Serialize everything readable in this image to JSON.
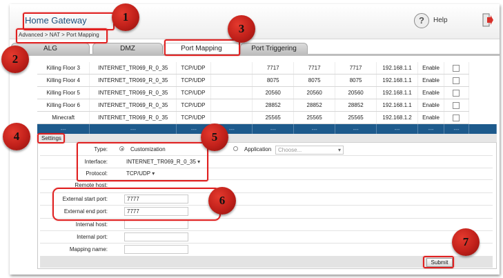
{
  "header": {
    "title": "Home Gateway",
    "help_label": "Help",
    "help_icon_glyph": "?"
  },
  "breadcrumb": "Advanced > NAT > Port Mapping",
  "tabs": [
    "ALG",
    "DMZ",
    "Port Mapping",
    "Port Triggering"
  ],
  "active_tab": "Port Mapping",
  "mapping_table": {
    "rows": [
      {
        "name": "Killing Floor 3",
        "interface": "INTERNET_TR069_R_0_35",
        "protocol": "TCP/UDP",
        "ext_start": "7717",
        "ext_end": "7717",
        "int_port": "7717",
        "host": "192.168.1.1",
        "status": "Enable"
      },
      {
        "name": "Killing Floor 4",
        "interface": "INTERNET_TR069_R_0_35",
        "protocol": "TCP/UDP",
        "ext_start": "8075",
        "ext_end": "8075",
        "int_port": "8075",
        "host": "192.168.1.1",
        "status": "Enable"
      },
      {
        "name": "Killing Floor 5",
        "interface": "INTERNET_TR069_R_0_35",
        "protocol": "TCP/UDP",
        "ext_start": "20560",
        "ext_end": "20560",
        "int_port": "20560",
        "host": "192.168.1.1",
        "status": "Enable"
      },
      {
        "name": "Killing Floor 6",
        "interface": "INTERNET_TR069_R_0_35",
        "protocol": "TCP/UDP",
        "ext_start": "28852",
        "ext_end": "28852",
        "int_port": "28852",
        "host": "192.168.1.1",
        "status": "Enable"
      },
      {
        "name": "Minecraft",
        "interface": "INTERNET_TR069_R_0_35",
        "protocol": "TCP/UDP",
        "ext_start": "25565",
        "ext_end": "25565",
        "int_port": "25565",
        "host": "192.168.1.2",
        "status": "Enable"
      }
    ],
    "new_row_placeholder": "---"
  },
  "settings": {
    "title": "Settings",
    "type_label": "Type:",
    "type_option_custom": "Customization",
    "type_option_app": "Application",
    "app_select_placeholder": "Choose...",
    "interface_label": "Interface:",
    "interface_value": "INTERNET_TR069_R_0_35",
    "protocol_label": "Protocol:",
    "protocol_value": "TCP/UDP",
    "remote_host_label": "Remote host:",
    "ext_start_label": "External start port:",
    "ext_start_value": "7777",
    "ext_end_label": "External end port:",
    "ext_end_value": "7777",
    "internal_host_label": "Internal host:",
    "internal_port_label": "Internal port:",
    "mapping_name_label": "Mapping name:",
    "submit_label": "Submit"
  },
  "annotations": [
    "1",
    "2",
    "3",
    "4",
    "5",
    "6",
    "7"
  ],
  "colors": {
    "title": "#1c4f7c",
    "table_highlight": "#1d5a8c",
    "annotation": "#c0201a",
    "highlight_border": "#e02020"
  }
}
